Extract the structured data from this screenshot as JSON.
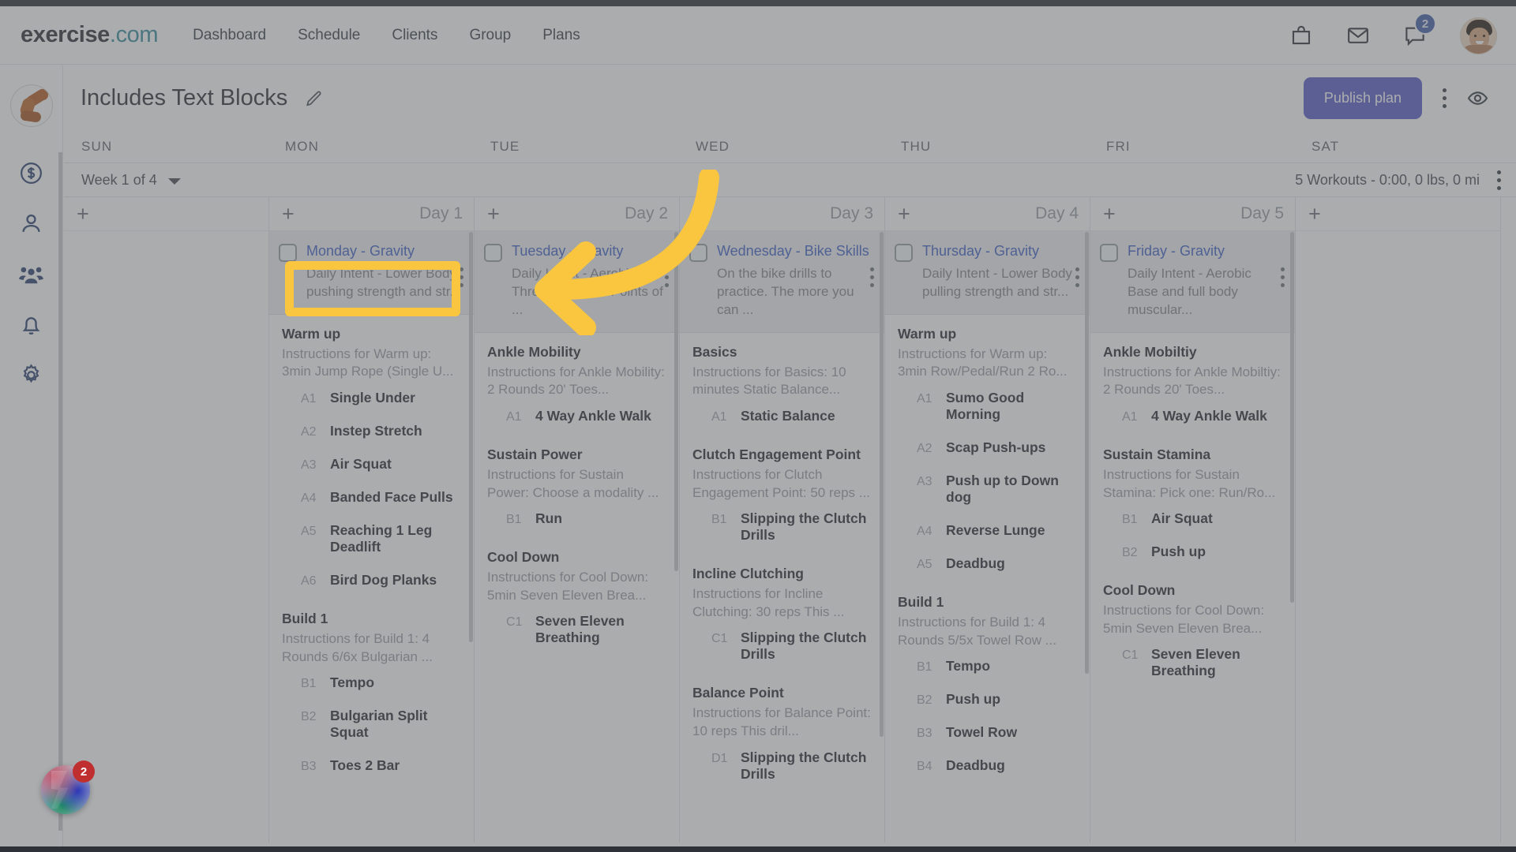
{
  "app": {
    "brand_name": "exercise",
    "brand_suffix": ".com"
  },
  "topnav": {
    "links": [
      {
        "label": "Dashboard"
      },
      {
        "label": "Schedule"
      },
      {
        "label": "Clients"
      },
      {
        "label": "Group"
      },
      {
        "label": "Plans"
      }
    ],
    "icons": [
      {
        "name": "shopping-bag-icon"
      },
      {
        "name": "mail-icon"
      },
      {
        "name": "chat-icon",
        "badge": "2"
      }
    ],
    "avatar_label": "User avatar"
  },
  "sidebar": {
    "logo_label": "Trainer logo",
    "items": [
      {
        "name": "billing-icon"
      },
      {
        "name": "client-icon"
      },
      {
        "name": "group-icon"
      },
      {
        "name": "notifications-icon"
      },
      {
        "name": "settings-icon"
      }
    ]
  },
  "page": {
    "title": "Includes Text Blocks",
    "edit_label": "Edit name",
    "publish_label": "Publish plan",
    "more_label": "More options",
    "preview_label": "Preview"
  },
  "calendar": {
    "day_headers": [
      "SUN",
      "MON",
      "TUE",
      "WED",
      "THU",
      "FRI",
      "SAT"
    ],
    "week_selector": "Week 1 of 4",
    "week_stats": "5 Workouts - 0:00, 0 lbs, 0 mi",
    "add_label": "+",
    "columns": [
      {
        "day_number": "",
        "workout": null,
        "blocks": []
      },
      {
        "day_number": "Day 1",
        "workout": {
          "title": "Monday - Gravity",
          "description": "Daily Intent - Lower Body pushing strength and str..."
        },
        "blocks": [
          {
            "title": "Warm up",
            "instructions": "Instructions for Warm up: 3min Jump Rope (Single U...",
            "exercises": [
              {
                "code": "A1",
                "name": "Single Under"
              },
              {
                "code": "A2",
                "name": "Instep Stretch"
              },
              {
                "code": "A3",
                "name": "Air Squat"
              },
              {
                "code": "A4",
                "name": "Banded Face Pulls"
              },
              {
                "code": "A5",
                "name": "Reaching 1 Leg Deadlift"
              },
              {
                "code": "A6",
                "name": "Bird Dog Planks"
              }
            ]
          },
          {
            "title": "Build 1",
            "instructions": "Instructions for Build 1: 4 Rounds 6/6x Bulgarian ...",
            "exercises": [
              {
                "code": "B1",
                "name": "Tempo"
              },
              {
                "code": "B2",
                "name": "Bulgarian Split Squat"
              },
              {
                "code": "B3",
                "name": "Toes 2 Bar"
              }
            ]
          }
        ]
      },
      {
        "day_number": "Day 2",
        "workout": {
          "title": "Tuesday - Gravity",
          "description": "Daily Intent - Aerobic Threshold work. Points of ..."
        },
        "blocks": [
          {
            "title": "Ankle Mobility",
            "instructions": "Instructions for Ankle Mobility: 2 Rounds 20' Toes...",
            "exercises": [
              {
                "code": "A1",
                "name": "4 Way Ankle Walk"
              }
            ]
          },
          {
            "title": "Sustain Power",
            "instructions": "Instructions for Sustain Power: Choose a modality ...",
            "exercises": [
              {
                "code": "B1",
                "name": "Run"
              }
            ]
          },
          {
            "title": "Cool Down",
            "instructions": "Instructions for Cool Down: 5min Seven Eleven Brea...",
            "exercises": [
              {
                "code": "C1",
                "name": "Seven Eleven Breathing"
              }
            ]
          }
        ]
      },
      {
        "day_number": "Day 3",
        "workout": {
          "title": "Wednesday - Bike Skills",
          "description": "On the bike drills to practice. The more you can ..."
        },
        "blocks": [
          {
            "title": "Basics",
            "instructions": "Instructions for Basics: 10 minutes Static Balance...",
            "exercises": [
              {
                "code": "A1",
                "name": "Static Balance"
              }
            ]
          },
          {
            "title": "Clutch Engagement Point",
            "instructions": "Instructions for Clutch Engagement Point: 50 reps ...",
            "exercises": [
              {
                "code": "B1",
                "name": "Slipping the Clutch Drills"
              }
            ]
          },
          {
            "title": "Incline Clutching",
            "instructions": "Instructions for Incline Clutching: 30 reps This ...",
            "exercises": [
              {
                "code": "C1",
                "name": "Slipping the Clutch Drills"
              }
            ]
          },
          {
            "title": "Balance Point",
            "instructions": "Instructions for Balance Point: 10 reps This dril...",
            "exercises": [
              {
                "code": "D1",
                "name": "Slipping the Clutch Drills"
              }
            ]
          }
        ]
      },
      {
        "day_number": "Day 4",
        "workout": {
          "title": "Thursday - Gravity",
          "description": "Daily Intent - Lower Body pulling strength and str..."
        },
        "blocks": [
          {
            "title": "Warm up",
            "instructions": "Instructions for Warm up: 3min Row/Pedal/Run 2 Ro...",
            "exercises": [
              {
                "code": "A1",
                "name": "Sumo Good Morning"
              },
              {
                "code": "A2",
                "name": "Scap Push-ups"
              },
              {
                "code": "A3",
                "name": "Push up to Down dog"
              },
              {
                "code": "A4",
                "name": "Reverse Lunge"
              },
              {
                "code": "A5",
                "name": "Deadbug"
              }
            ]
          },
          {
            "title": "Build 1",
            "instructions": "Instructions for Build 1: 4 Rounds 5/5x Towel Row ...",
            "exercises": [
              {
                "code": "B1",
                "name": "Tempo"
              },
              {
                "code": "B2",
                "name": "Push up"
              },
              {
                "code": "B3",
                "name": "Towel Row"
              },
              {
                "code": "B4",
                "name": "Deadbug"
              }
            ]
          }
        ]
      },
      {
        "day_number": "Day 5",
        "workout": {
          "title": "Friday - Gravity",
          "description": "Daily Intent - Aerobic Base and full body muscular..."
        },
        "blocks": [
          {
            "title": "Ankle Mobiltiy",
            "instructions": "Instructions for Ankle Mobiltiy: 2 Rounds 20' Toes...",
            "exercises": [
              {
                "code": "A1",
                "name": "4 Way Ankle Walk"
              }
            ]
          },
          {
            "title": "Sustain Stamina",
            "instructions": "Instructions for Sustain Stamina: Pick one: Run/Ro...",
            "exercises": [
              {
                "code": "B1",
                "name": "Air Squat"
              },
              {
                "code": "B2",
                "name": "Push up"
              }
            ]
          },
          {
            "title": "Cool Down",
            "instructions": "Instructions for Cool Down: 5min Seven Eleven Brea...",
            "exercises": [
              {
                "code": "C1",
                "name": "Seven Eleven Breathing"
              }
            ]
          }
        ]
      },
      {
        "day_number": "",
        "workout": null,
        "blocks": []
      }
    ]
  },
  "floating_widget": {
    "badge": "2",
    "label": "Assistant"
  },
  "annotation": {
    "highlight_target": "Monday - Gravity",
    "arrow_color": "#fbc63f",
    "highlight_color": "#fbc63f"
  }
}
